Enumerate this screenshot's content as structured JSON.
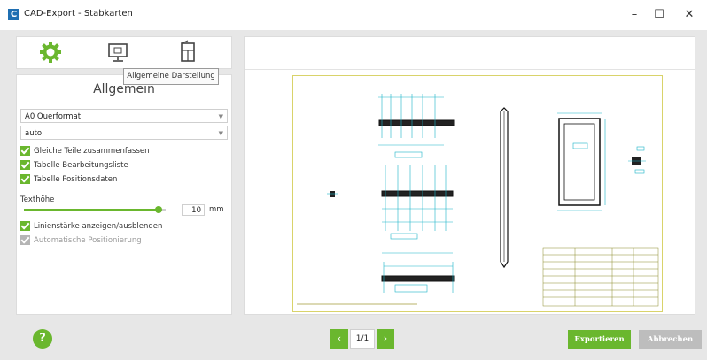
{
  "window": {
    "title": "CAD-Export - Stabkarten",
    "app_icon": "C",
    "controls": {
      "minimize": "–",
      "maximize": "☐",
      "close": "✕"
    }
  },
  "toolbar": {
    "icons": [
      "gear-icon",
      "monitor-icon",
      "window-frame-icon"
    ],
    "tooltip": "Allgemeine Darstellung",
    "accent": "#6ab72e"
  },
  "settings": {
    "title": "Allgemein",
    "format_select": "A0 Querformat",
    "scale_select": "auto",
    "checkboxes": [
      {
        "label": "Gleiche Teile zusammenfassen",
        "checked": true,
        "enabled": true
      },
      {
        "label": "Tabelle Bearbeitungsliste",
        "checked": true,
        "enabled": true
      },
      {
        "label": "Tabelle Positionsdaten",
        "checked": true,
        "enabled": true
      }
    ],
    "text_height_label": "Texthöhe",
    "text_height_value": "10",
    "text_height_level": 0.95,
    "text_height_unit": "mm",
    "checkboxes2": [
      {
        "label": "Linienstärke anzeigen/ausblenden",
        "checked": true,
        "enabled": true
      },
      {
        "label": "Automatische Positionierung",
        "checked": true,
        "enabled": false
      }
    ]
  },
  "footer": {
    "help": "?",
    "prev": "‹",
    "page": "1/1",
    "next": "›",
    "export": "Exportieren",
    "cancel": "Abbrechen"
  }
}
